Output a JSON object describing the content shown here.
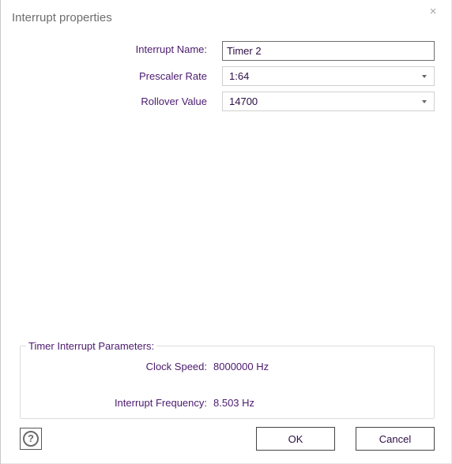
{
  "dialog": {
    "title": "Interrupt properties",
    "close_glyph": "×"
  },
  "form": {
    "interrupt_name_label": "Interrupt Name:",
    "interrupt_name_value": "Timer 2",
    "prescaler_label": "Prescaler Rate",
    "prescaler_value": "1:64",
    "rollover_label": "Rollover Value",
    "rollover_value": "14700"
  },
  "parameters": {
    "group_title": "Timer Interrupt Parameters:",
    "clock_speed_label": "Clock Speed:",
    "clock_speed_value": "8000000 Hz",
    "frequency_label": "Interrupt Frequency:",
    "frequency_value": "8.503 Hz"
  },
  "footer": {
    "help_glyph": "?",
    "help_icon": "question-circle-icon",
    "ok_label": "OK",
    "cancel_label": "Cancel"
  },
  "colors": {
    "label_text": "#4b1a6e",
    "title_text": "#6e6e6e"
  }
}
